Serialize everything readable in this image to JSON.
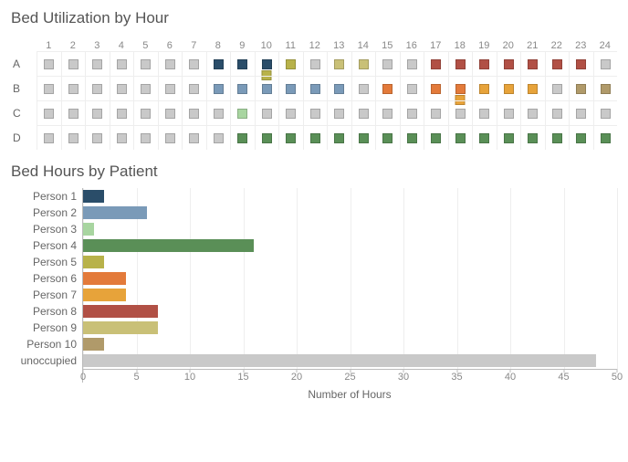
{
  "titles": {
    "heatmap": "Bed Utilization by Hour",
    "bars": "Bed Hours by Patient",
    "xaxis": "Number of Hours"
  },
  "colors": {
    "unoccupied": "#c9c9c9",
    "Person 1": "#2a4d69",
    "Person 2": "#7a9ab8",
    "Person 3": "#a8d5a0",
    "Person 4": "#5a8f57",
    "Person 5": "#b8b24a",
    "Person 6": "#e37a3a",
    "Person 7": "#e7a33a",
    "Person 8": "#b15045",
    "Person 9": "#c9c077",
    "Person 10": "#b09a6a"
  },
  "chart_data": [
    {
      "type": "heatmap",
      "title": "Bed Utilization by Hour",
      "categories_x": [
        1,
        2,
        3,
        4,
        5,
        6,
        7,
        8,
        9,
        10,
        11,
        12,
        13,
        14,
        15,
        16,
        17,
        18,
        19,
        20,
        21,
        22,
        23,
        24
      ],
      "categories_y": [
        "A",
        "B",
        "C",
        "D"
      ],
      "series": [
        {
          "bed": "A",
          "hours": [
            [
              "unoccupied"
            ],
            [
              "unoccupied"
            ],
            [
              "unoccupied"
            ],
            [
              "unoccupied"
            ],
            [
              "unoccupied"
            ],
            [
              "unoccupied"
            ],
            [
              "unoccupied"
            ],
            [
              "Person 1"
            ],
            [
              "Person 1"
            ],
            [
              "Person 1",
              "Person 5"
            ],
            [
              "Person 5"
            ],
            [
              "unoccupied"
            ],
            [
              "Person 9"
            ],
            [
              "Person 9"
            ],
            [
              "unoccupied"
            ],
            [
              "unoccupied"
            ],
            [
              "Person 8"
            ],
            [
              "Person 8"
            ],
            [
              "Person 8"
            ],
            [
              "Person 8"
            ],
            [
              "Person 8"
            ],
            [
              "Person 8"
            ],
            [
              "Person 8"
            ],
            [
              "unoccupied"
            ]
          ]
        },
        {
          "bed": "B",
          "hours": [
            [
              "unoccupied"
            ],
            [
              "unoccupied"
            ],
            [
              "unoccupied"
            ],
            [
              "unoccupied"
            ],
            [
              "unoccupied"
            ],
            [
              "unoccupied"
            ],
            [
              "unoccupied"
            ],
            [
              "Person 2"
            ],
            [
              "Person 2"
            ],
            [
              "Person 2"
            ],
            [
              "Person 2"
            ],
            [
              "Person 2"
            ],
            [
              "Person 2"
            ],
            [
              "unoccupied"
            ],
            [
              "Person 6"
            ],
            [
              "unoccupied"
            ],
            [
              "Person 6"
            ],
            [
              "Person 6",
              "Person 7"
            ],
            [
              "Person 7"
            ],
            [
              "Person 7"
            ],
            [
              "Person 7"
            ],
            [
              "unoccupied"
            ],
            [
              "Person 10"
            ],
            [
              "Person 10"
            ]
          ]
        },
        {
          "bed": "C",
          "hours": [
            [
              "unoccupied"
            ],
            [
              "unoccupied"
            ],
            [
              "unoccupied"
            ],
            [
              "unoccupied"
            ],
            [
              "unoccupied"
            ],
            [
              "unoccupied"
            ],
            [
              "unoccupied"
            ],
            [
              "unoccupied"
            ],
            [
              "Person 3"
            ],
            [
              "unoccupied"
            ],
            [
              "unoccupied"
            ],
            [
              "unoccupied"
            ],
            [
              "unoccupied"
            ],
            [
              "unoccupied"
            ],
            [
              "unoccupied"
            ],
            [
              "unoccupied"
            ],
            [
              "unoccupied"
            ],
            [
              "unoccupied"
            ],
            [
              "unoccupied"
            ],
            [
              "unoccupied"
            ],
            [
              "unoccupied"
            ],
            [
              "unoccupied"
            ],
            [
              "unoccupied"
            ],
            [
              "unoccupied"
            ]
          ]
        },
        {
          "bed": "D",
          "hours": [
            [
              "unoccupied"
            ],
            [
              "unoccupied"
            ],
            [
              "unoccupied"
            ],
            [
              "unoccupied"
            ],
            [
              "unoccupied"
            ],
            [
              "unoccupied"
            ],
            [
              "unoccupied"
            ],
            [
              "unoccupied"
            ],
            [
              "Person 4"
            ],
            [
              "Person 4"
            ],
            [
              "Person 4"
            ],
            [
              "Person 4"
            ],
            [
              "Person 4"
            ],
            [
              "Person 4"
            ],
            [
              "Person 4"
            ],
            [
              "Person 4"
            ],
            [
              "Person 4"
            ],
            [
              "Person 4"
            ],
            [
              "Person 4"
            ],
            [
              "Person 4"
            ],
            [
              "Person 4"
            ],
            [
              "Person 4"
            ],
            [
              "Person 4"
            ],
            [
              "Person 4"
            ]
          ]
        }
      ]
    },
    {
      "type": "bar",
      "title": "Bed Hours by Patient",
      "xlabel": "Number of Hours",
      "xlim": [
        0,
        50
      ],
      "xticks": [
        0,
        5,
        10,
        15,
        20,
        25,
        30,
        35,
        40,
        45,
        50
      ],
      "categories": [
        "Person 1",
        "Person 2",
        "Person 3",
        "Person 4",
        "Person 5",
        "Person 6",
        "Person 7",
        "Person 8",
        "Person 9",
        "Person 10",
        "unoccupied"
      ],
      "values": [
        2,
        6,
        1,
        16,
        2,
        4,
        4,
        7,
        7,
        2,
        48
      ]
    }
  ]
}
